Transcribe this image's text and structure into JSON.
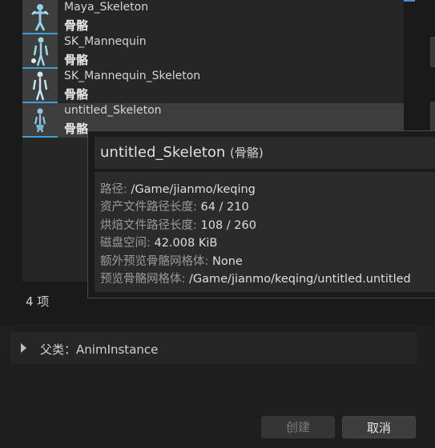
{
  "assets": [
    {
      "name": "Maya_Skeleton",
      "type": "骨骼"
    },
    {
      "name": "SK_Mannequin",
      "type": "骨骼"
    },
    {
      "name": "SK_Mannequin_Skeleton",
      "type": "骨骼"
    },
    {
      "name": "untitled_Skeleton",
      "type": "骨骼"
    }
  ],
  "count_label": "4 项",
  "parent_class": {
    "label": "父类：",
    "value": "AnimInstance"
  },
  "buttons": {
    "create": "创建",
    "cancel": "取消"
  },
  "tooltip": {
    "title": "untitled_Skeleton",
    "title_type": "(骨骼)",
    "lines": [
      {
        "key": "路径: ",
        "value": "/Game/jianmo/keqing"
      },
      {
        "key": "资产文件路径长度: ",
        "value": "64 / 210"
      },
      {
        "key": "烘焙文件路径长度: ",
        "value": "108 / 260"
      },
      {
        "key": "磁盘空间: ",
        "value": "42.008 KiB"
      },
      {
        "key": "额外预览骨骼网格体: ",
        "value": "None"
      },
      {
        "key": "预览骨骼网格体: ",
        "value": "/Game/jianmo/keqing/untitled.untitled"
      }
    ]
  },
  "colors": {
    "thumb_accent": "#3aa0d6",
    "selected_row": "#3c3c3c",
    "panel_bg": "#1a1a1a"
  },
  "icons": {
    "thumbnail": "skeleton-figure-icon",
    "expand": "triangle-right-icon"
  }
}
